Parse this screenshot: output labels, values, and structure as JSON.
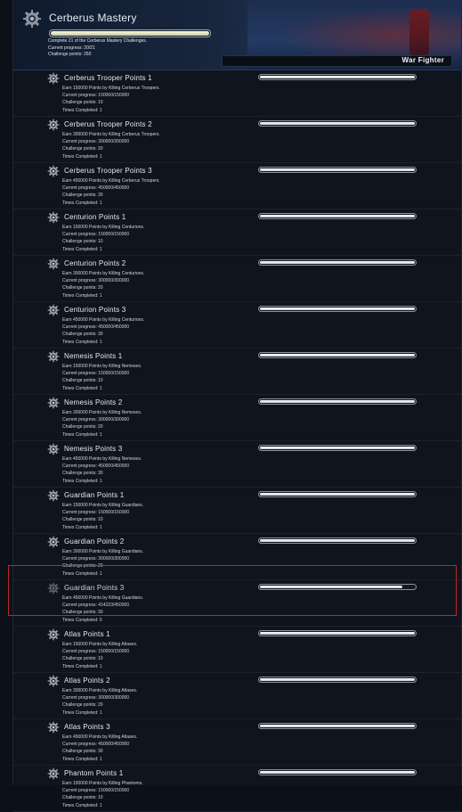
{
  "header": {
    "title": "Cerberus Mastery",
    "progress_fraction": 1.0,
    "line1": "Complete 21 of the Cerberus Mastery Challenges.",
    "line2": "Current progress: 20/21",
    "line3": "Challenge points: 250",
    "tab_label": "War Fighter",
    "icon": "gear-badge-icon"
  },
  "items": [
    {
      "name": "Cerberus Trooper Points 1",
      "desc": "Earn 150000 Points by Killing Cerberus Troopers.",
      "progress": "Current progress: 150000/150000",
      "points": "Challenge points: 10",
      "times": "Times Completed: 1",
      "fraction": 1.0,
      "completed": true
    },
    {
      "name": "Cerberus Trooper Points 2",
      "desc": "Earn 300000 Points by Killing Cerberus Troopers.",
      "progress": "Current progress: 300000/300000",
      "points": "Challenge points: 20",
      "times": "Times Completed: 1",
      "fraction": 1.0,
      "completed": true
    },
    {
      "name": "Cerberus Trooper Points 3",
      "desc": "Earn 450000 Points by Killing Cerberus Troopers.",
      "progress": "Current progress: 450000/450000",
      "points": "Challenge points: 30",
      "times": "Times Completed: 1",
      "fraction": 1.0,
      "completed": true
    },
    {
      "name": "Centurion Points 1",
      "desc": "Earn 150000 Points by Killing Centurions.",
      "progress": "Current progress: 150000/150000",
      "points": "Challenge points: 10",
      "times": "Times Completed: 1",
      "fraction": 1.0,
      "completed": true
    },
    {
      "name": "Centurion Points 2",
      "desc": "Earn 300000 Points by Killing Centurions.",
      "progress": "Current progress: 300000/300000",
      "points": "Challenge points: 20",
      "times": "Times Completed: 1",
      "fraction": 1.0,
      "completed": true
    },
    {
      "name": "Centurion Points 3",
      "desc": "Earn 450000 Points by Killing Centurions.",
      "progress": "Current progress: 450000/450000",
      "points": "Challenge points: 30",
      "times": "Times Completed: 1",
      "fraction": 1.0,
      "completed": true
    },
    {
      "name": "Nemesis Points 1",
      "desc": "Earn 150000 Points by Killing Nemeses.",
      "progress": "Current progress: 150000/150000",
      "points": "Challenge points: 10",
      "times": "Times Completed: 1",
      "fraction": 1.0,
      "completed": true
    },
    {
      "name": "Nemesis Points 2",
      "desc": "Earn 300000 Points by Killing Nemeses.",
      "progress": "Current progress: 300000/300000",
      "points": "Challenge points: 20",
      "times": "Times Completed: 1",
      "fraction": 1.0,
      "completed": true
    },
    {
      "name": "Nemesis Points 3",
      "desc": "Earn 450000 Points by Killing Nemeses.",
      "progress": "Current progress: 450000/450000",
      "points": "Challenge points: 30",
      "times": "Times Completed: 1",
      "fraction": 1.0,
      "completed": true
    },
    {
      "name": "Guardian Points 1",
      "desc": "Earn 150000 Points by Killing Guardians.",
      "progress": "Current progress: 150000/150000",
      "points": "Challenge points: 10",
      "times": "Times Completed: 1",
      "fraction": 1.0,
      "completed": true
    },
    {
      "name": "Guardian Points 2",
      "desc": "Earn 300000 Points by Killing Guardians.",
      "progress": "Current progress: 300000/300000",
      "points": "Challenge points: 20",
      "times": "Times Completed: 1",
      "fraction": 1.0,
      "completed": true
    },
    {
      "name": "Guardian Points 3",
      "desc": "Earn 450000 Points by Killing Guardians.",
      "progress": "Current progress: 414223/450000",
      "points": "Challenge points: 30",
      "times": "Times Completed: 0",
      "fraction": 0.92,
      "completed": false
    },
    {
      "name": "Atlas Points 1",
      "desc": "Earn 150000 Points by Killing Atlases.",
      "progress": "Current progress: 150000/150000",
      "points": "Challenge points: 10",
      "times": "Times Completed: 1",
      "fraction": 1.0,
      "completed": true
    },
    {
      "name": "Atlas Points 2",
      "desc": "Earn 300000 Points by Killing Atlases.",
      "progress": "Current progress: 300000/300000",
      "points": "Challenge points: 20",
      "times": "Times Completed: 1",
      "fraction": 1.0,
      "completed": true
    },
    {
      "name": "Atlas Points 3",
      "desc": "Earn 450000 Points by Killing Atlases.",
      "progress": "Current progress: 450000/450000",
      "points": "Challenge points: 30",
      "times": "Times Completed: 1",
      "fraction": 1.0,
      "completed": true
    },
    {
      "name": "Phantom Points 1",
      "desc": "Earn 150000 Points by Killing Phantoms.",
      "progress": "Current progress: 150000/150000",
      "points": "Challenge points: 10",
      "times": "Times Completed: 1",
      "fraction": 1.0,
      "completed": true
    }
  ],
  "highlight_color": "#c0242c",
  "item_icon": "gear-badge-icon"
}
